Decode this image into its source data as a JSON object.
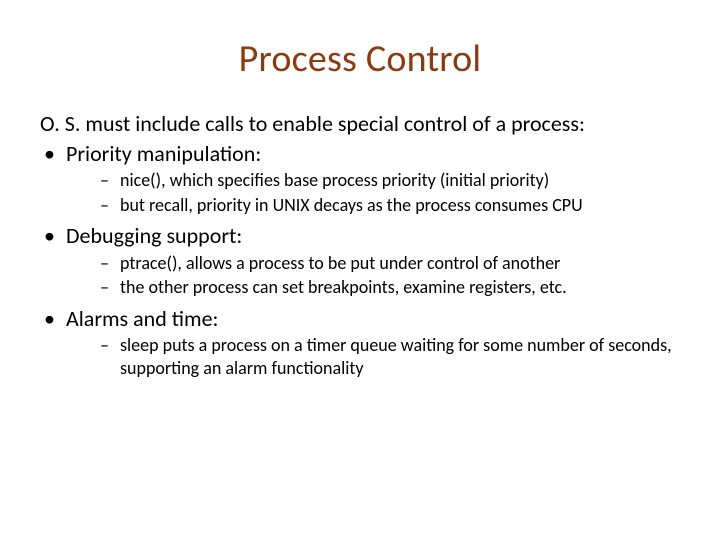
{
  "title": "Process Control",
  "intro": "O. S. must include calls to enable special control of a process:",
  "bullets": [
    {
      "label": "Priority manipulation:",
      "subs": [
        "nice(), which specifies base process priority (initial priority)",
        "but recall, priority in UNIX decays as the process consumes CPU"
      ]
    },
    {
      "label": "Debugging support:",
      "subs": [
        "ptrace(), allows a process to be put under control of another",
        "the other process can set breakpoints, examine registers, etc."
      ]
    },
    {
      "label": "Alarms and time:",
      "subs": [
        "sleep puts a process on a timer queue waiting for some number of seconds, supporting an alarm functionality"
      ]
    }
  ]
}
